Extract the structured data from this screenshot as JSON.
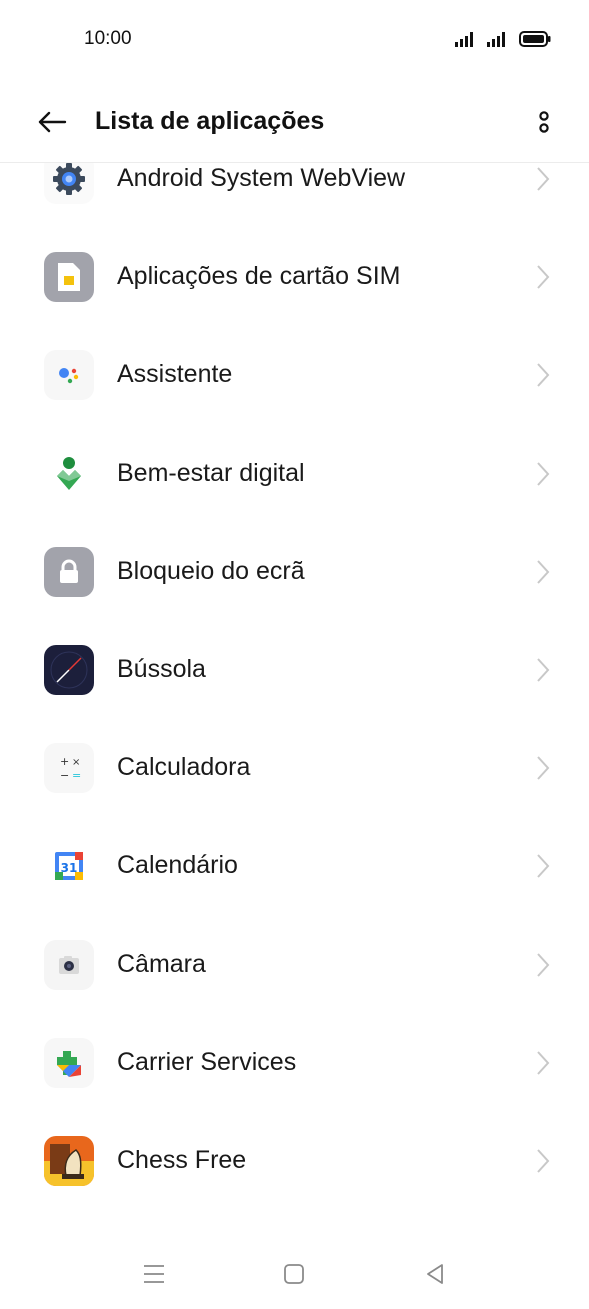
{
  "status": {
    "time": "10:00"
  },
  "header": {
    "title": "Lista de aplicações",
    "back_icon": "arrow-left-icon",
    "more_icon": "more-vertical-icon"
  },
  "apps": [
    {
      "label": "Android System WebView",
      "icon": "gear-icon"
    },
    {
      "label": "Aplicações de cartão SIM",
      "icon": "sim-card-icon"
    },
    {
      "label": "Assistente",
      "icon": "assistant-icon"
    },
    {
      "label": "Bem-estar digital",
      "icon": "digital-wellbeing-icon"
    },
    {
      "label": "Bloqueio do ecrã",
      "icon": "lock-icon"
    },
    {
      "label": "Bússola",
      "icon": "compass-icon"
    },
    {
      "label": "Calculadora",
      "icon": "calculator-icon"
    },
    {
      "label": "Calendário",
      "icon": "calendar-icon",
      "icon_text": "31"
    },
    {
      "label": "Câmara",
      "icon": "camera-icon"
    },
    {
      "label": "Carrier Services",
      "icon": "carrier-services-icon"
    },
    {
      "label": "Chess Free",
      "icon": "chess-icon"
    }
  ],
  "colors": {
    "accent_blue": "#1a73e8",
    "chevron": "#c8c8c8",
    "divider": "#ececec"
  }
}
